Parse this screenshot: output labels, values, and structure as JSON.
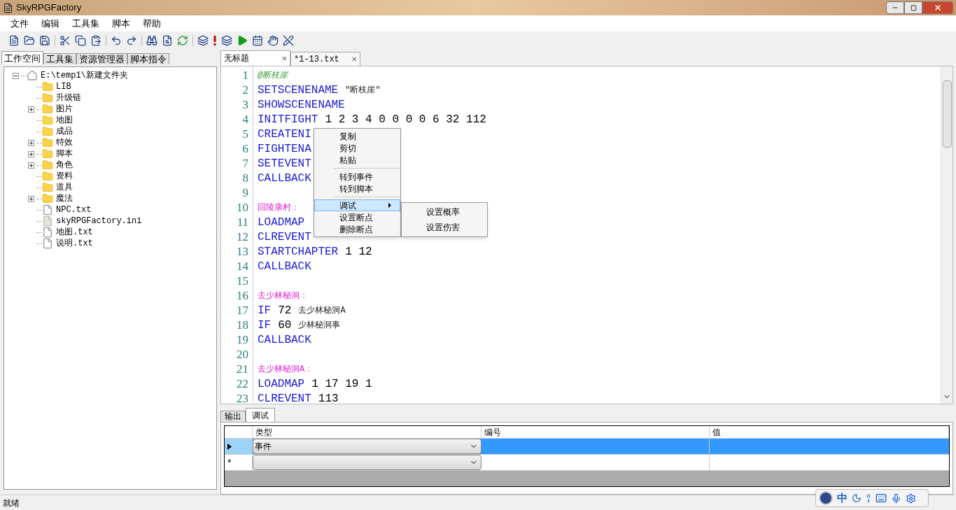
{
  "window": {
    "title": "SkyRPGFactory"
  },
  "menu": [
    "文件",
    "编辑",
    "工具集",
    "脚本",
    "帮助"
  ],
  "left_tabs": [
    {
      "label": "工作空间",
      "selected": true
    },
    {
      "label": "工具集",
      "selected": false
    },
    {
      "label": "资源管理器",
      "selected": false
    },
    {
      "label": "脚本指令",
      "selected": false
    }
  ],
  "tree": {
    "label": "E:\\temp1\\新建文件夹",
    "kind": "root",
    "expanded": true,
    "children": [
      {
        "label": "LIB",
        "kind": "folder"
      },
      {
        "label": "升级链",
        "kind": "folder"
      },
      {
        "label": "图片",
        "kind": "folder",
        "expanded": false
      },
      {
        "label": "地图",
        "kind": "folder"
      },
      {
        "label": "成品",
        "kind": "folder"
      },
      {
        "label": "特效",
        "kind": "folder",
        "expanded": false
      },
      {
        "label": "脚本",
        "kind": "folder",
        "expanded": false
      },
      {
        "label": "角色",
        "kind": "folder",
        "expanded": false
      },
      {
        "label": "资料",
        "kind": "folder"
      },
      {
        "label": "道具",
        "kind": "folder"
      },
      {
        "label": "魔法",
        "kind": "folder",
        "expanded": false
      },
      {
        "label": "NPC.txt",
        "kind": "file"
      },
      {
        "label": "skyRPGFactory.ini",
        "kind": "ini"
      },
      {
        "label": "地图.txt",
        "kind": "file"
      },
      {
        "label": "说明.txt",
        "kind": "file"
      }
    ]
  },
  "editor_tabs": [
    {
      "label": "无标题",
      "selected": true,
      "close": "×"
    },
    {
      "label": "*1-13.txt",
      "selected": false,
      "close": "×"
    }
  ],
  "code_lines": [
    {
      "number": "1",
      "segments": [
        {
          "kind": "comment",
          "text": "@断枝崖"
        }
      ]
    },
    {
      "number": "2",
      "segments": [
        {
          "kind": "keyword",
          "text": "SETSCENENAME"
        },
        {
          "kind": "text",
          "text": "\"断枝崖\""
        }
      ]
    },
    {
      "number": "3",
      "segments": [
        {
          "kind": "keyword",
          "text": "SHOWSCENENAME"
        }
      ]
    },
    {
      "number": "4",
      "segments": [
        {
          "kind": "keyword",
          "text": "INITFIGHT"
        },
        {
          "kind": "number",
          "text": "1 2 3 4 0 0 0 0 6 32 112"
        }
      ]
    },
    {
      "number": "5",
      "segments": [
        {
          "kind": "keyword",
          "text": "CREATENI"
        }
      ]
    },
    {
      "number": "6",
      "segments": [
        {
          "kind": "keyword",
          "text": "FIGHTENA"
        }
      ]
    },
    {
      "number": "7",
      "segments": [
        {
          "kind": "keyword",
          "text": "SETEVENT"
        }
      ]
    },
    {
      "number": "8",
      "segments": [
        {
          "kind": "keyword",
          "text": "CALLBACK"
        }
      ]
    },
    {
      "number": "9"
    },
    {
      "number": "10",
      "segments": [
        {
          "kind": "label",
          "text": "回陵康村："
        }
      ]
    },
    {
      "number": "11",
      "segments": [
        {
          "kind": "keyword",
          "text": "LOADMAP"
        }
      ]
    },
    {
      "number": "12",
      "segments": [
        {
          "kind": "keyword",
          "text": "CLREVENT"
        }
      ]
    },
    {
      "number": "13",
      "segments": [
        {
          "kind": "keyword",
          "text": "STARTCHAPTER"
        },
        {
          "kind": "number",
          "text": "1 12"
        }
      ]
    },
    {
      "number": "14",
      "segments": [
        {
          "kind": "keyword",
          "text": "CALLBACK"
        }
      ]
    },
    {
      "number": "15"
    },
    {
      "number": "16",
      "segments": [
        {
          "kind": "label",
          "text": "去少林秘洞："
        }
      ]
    },
    {
      "number": "17",
      "segments": [
        {
          "kind": "keyword",
          "text": "IF"
        },
        {
          "kind": "number",
          "text": "72"
        },
        {
          "kind": "text",
          "text": "去少林秘洞A"
        }
      ]
    },
    {
      "number": "18",
      "segments": [
        {
          "kind": "keyword",
          "text": "IF"
        },
        {
          "kind": "number",
          "text": "60"
        },
        {
          "kind": "text",
          "text": "少林秘洞事"
        }
      ]
    },
    {
      "number": "19",
      "segments": [
        {
          "kind": "keyword",
          "text": "CALLBACK"
        }
      ]
    },
    {
      "number": "20"
    },
    {
      "number": "21",
      "segments": [
        {
          "kind": "label",
          "text": "去少林秘洞A："
        }
      ]
    },
    {
      "number": "22",
      "segments": [
        {
          "kind": "keyword",
          "text": "LOADMAP"
        },
        {
          "kind": "number",
          "text": "1 17 19 1"
        }
      ]
    },
    {
      "number": "23",
      "segments": [
        {
          "kind": "keyword",
          "text": "CLREVENT"
        },
        {
          "kind": "number",
          "text": "113"
        }
      ]
    }
  ],
  "context_menu": {
    "items": [
      {
        "kind": "item",
        "label": "复制",
        "selected": false
      },
      {
        "kind": "item",
        "label": "剪切",
        "selected": false
      },
      {
        "kind": "item",
        "label": "粘贴",
        "selected": false
      },
      {
        "kind": "separator"
      },
      {
        "kind": "item",
        "label": "转到事件",
        "selected": false
      },
      {
        "kind": "item",
        "label": "转到脚本",
        "selected": false
      },
      {
        "kind": "separator"
      },
      {
        "kind": "submenu",
        "label": "调试",
        "selected": true
      },
      {
        "kind": "item",
        "label": "设置断点",
        "selected": false
      },
      {
        "kind": "item",
        "label": "删除断点",
        "selected": false
      }
    ],
    "submenu": [
      "设置概率",
      "设置伤害"
    ]
  },
  "bottom_tabs": [
    {
      "label": "输出",
      "selected": false
    },
    {
      "label": "调试",
      "selected": true
    }
  ],
  "grid": {
    "columns": [
      "类型",
      "编号",
      "值"
    ],
    "rows": [
      {
        "kind": "current",
        "selected": true,
        "type": "事件"
      },
      {
        "kind": "new",
        "selected": false,
        "marker": "*"
      }
    ]
  },
  "ime": {
    "label": "中"
  },
  "status_bar": "就绪"
}
